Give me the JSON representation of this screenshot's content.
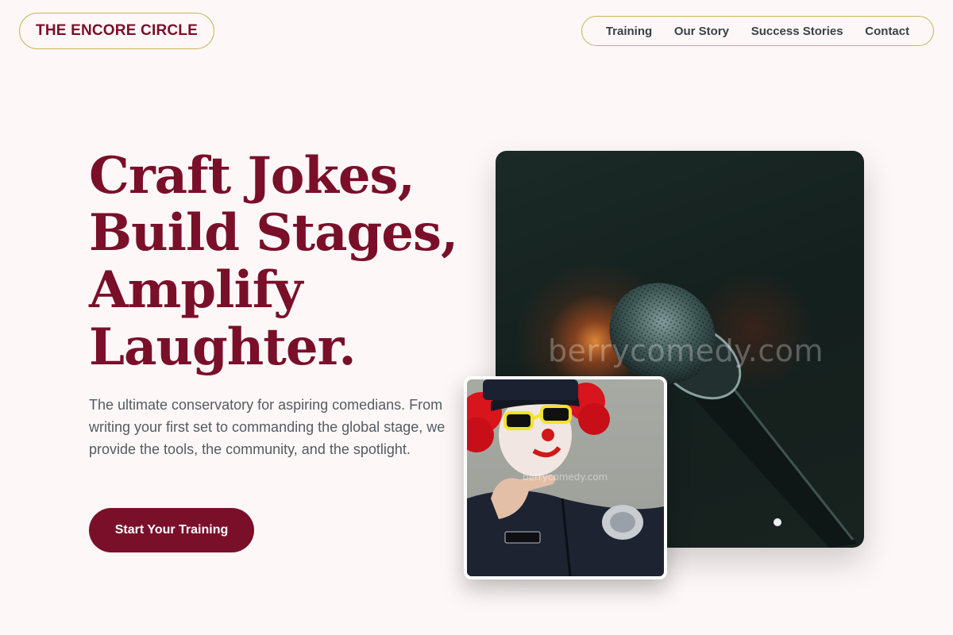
{
  "header": {
    "logo_text": "THE ENCORE CIRCLE",
    "nav": [
      {
        "label": "Training"
      },
      {
        "label": "Our Story"
      },
      {
        "label": "Success Stories"
      },
      {
        "label": "Contact"
      }
    ]
  },
  "hero": {
    "title_lines": [
      "Craft Jokes,",
      "Build Stages,",
      "Amplify",
      "Laughter."
    ],
    "subtitle": "The ultimate conservatory for aspiring comedians. From writing your first set to commanding the global stage, we provide the tools, the community, and the spotlight.",
    "cta_label": "Start Your Training"
  },
  "images": {
    "main_image": "microphone-photo",
    "main_watermark": "berrycomedy.com",
    "inset_image": "clown-police-officer-photo",
    "inset_watermark": "berrycomedy.com"
  },
  "colors": {
    "brand": "#7a0f2a",
    "accent_border": "#c9b35a",
    "background": "#fdf8f7",
    "body_text": "#555a63"
  }
}
